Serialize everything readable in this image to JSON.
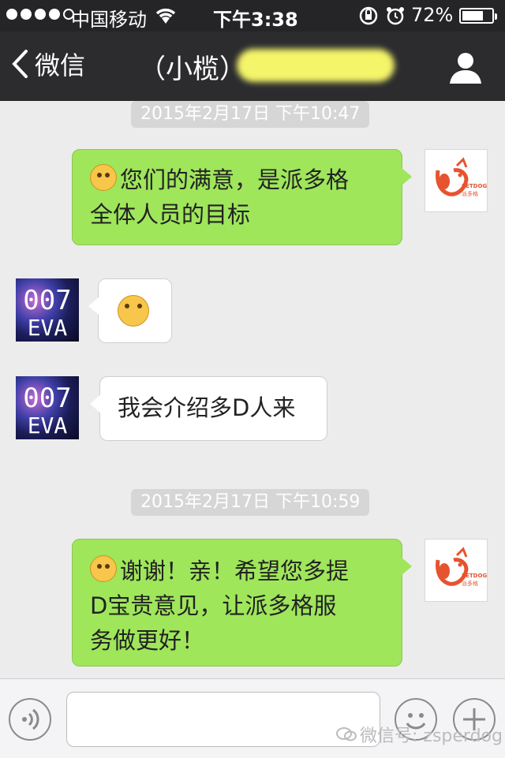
{
  "status_bar": {
    "carrier": "中国移动",
    "time": "下午3:38",
    "battery_percent": "72%",
    "battery_level": 0.72,
    "signal_bars": 4,
    "icons": [
      "signal-dots-icon",
      "wifi-icon",
      "rotation-lock-icon",
      "alarm-icon",
      "battery-icon"
    ]
  },
  "nav": {
    "back_label": "微信",
    "title": "（小榄）",
    "title_redacted": true,
    "profile_icon": "person-icon"
  },
  "messages": [
    {
      "type": "timestamp",
      "text": "2015年2月17日 下午10:47"
    },
    {
      "type": "sent",
      "sender": "PETDOG",
      "emoji": "kiss-face",
      "lines": [
        "您们的满意，是派多格",
        "全体人员的目标"
      ]
    },
    {
      "type": "received",
      "sender": "007 EVA",
      "emoji": "grin-face"
    },
    {
      "type": "received",
      "sender": "007 EVA",
      "lines": [
        "我会介绍多D人来"
      ]
    },
    {
      "type": "timestamp",
      "text": "2015年2月17日 下午10:59"
    },
    {
      "type": "sent",
      "sender": "PETDOG",
      "emoji": "smile-face",
      "lines": [
        "谢谢！亲！希望您多提",
        "D宝贵意见，让派多格服",
        "务做更好！"
      ]
    }
  ],
  "avatars": {
    "petdog": {
      "brand": "PETDOG",
      "sub": "派多格",
      "color": "#e5542f"
    },
    "eva": {
      "line1": "007",
      "line2": "EVA"
    }
  },
  "input_bar": {
    "text_value": "",
    "icons": [
      "voice-icon",
      "emoji-icon",
      "plus-icon"
    ]
  },
  "watermark": "微信号: zsperdog",
  "colors": {
    "sent_bubble": "#9fe65b",
    "received_bubble": "#ffffff",
    "navbar": "#2c2c2f"
  }
}
